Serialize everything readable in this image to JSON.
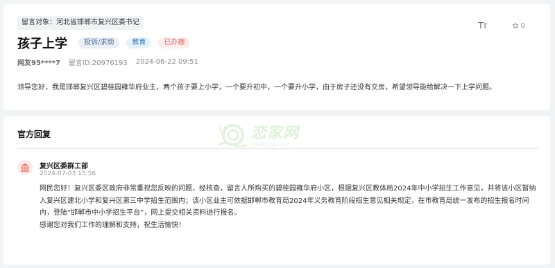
{
  "message": {
    "target_label": "留言对象：河北省邯郸市复兴区委书记",
    "title": "孩子上学",
    "tags": {
      "type": "投诉/求助",
      "category": "教育",
      "status": "已办理"
    },
    "user": "网友95****7",
    "message_id": "留言ID:20976193",
    "date": "2024-06-22 09:51",
    "content": "领导您好，我是邯郸复兴区碧桂园雍华府业主，两个孩子要上小学，一个要升初中，一个要升小学，由于房子还没有交房，希望领导能给解决一下上学问题。"
  },
  "tools": {
    "font_size_label": "Tт",
    "star_count": "0"
  },
  "reply": {
    "section_title": "官方回复",
    "department": "复兴区委群工部",
    "date": "2024-07-03 15:56",
    "body_paragraph_1": "网民您好！复兴区委区政府非常重视您反映的问题，经核查，留言人所购买的碧桂园雍华府小区，根据复兴区教体局2024年中小学招生工作意见，并将该小区暂纳入复兴区建北小学和复兴区第三中学招生范围内；该小区业主可依据邯郸市教育局2024年义务教育阶段招生意见相关规定，在市教育局统一发布的招生报名时间内，登陆“邯郸市中小学招生平台”，网上提交相关资料进行报名。",
    "body_paragraph_2": "感谢您对我们工作的理解和支持，祝生活愉快！"
  },
  "watermark": {
    "main": "恋家网",
    "sub": "www.Ljia.com"
  },
  "colors": {
    "page_bg": "#f2f3f5",
    "status_red": "#e05a5a",
    "category_blue": "#3a7ab8",
    "dept_icon_red": "#e06a5f"
  },
  "icons": {
    "font_tool": "text-size-icon",
    "star": "star-icon",
    "department": "government-building-icon"
  }
}
